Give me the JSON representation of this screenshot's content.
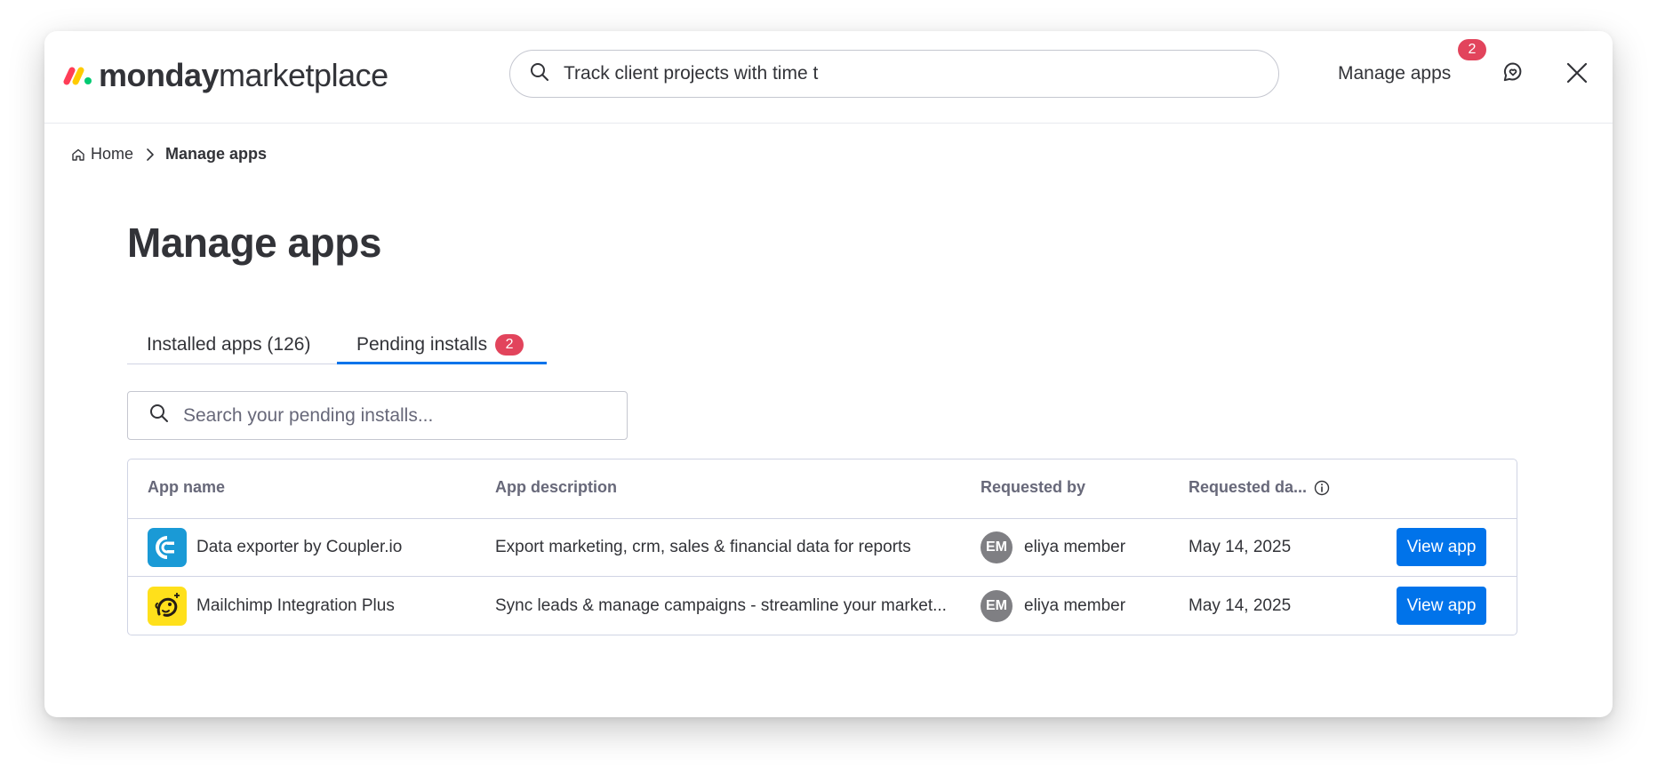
{
  "header": {
    "logo_bold": "monday",
    "logo_light": "marketplace",
    "search_value": "Track client projects with time t",
    "manage_apps_label": "Manage apps",
    "manage_apps_badge": "2",
    "icons": [
      "search-icon",
      "chat-icon",
      "close-icon"
    ]
  },
  "breadcrumb": {
    "home_label": "Home",
    "current_label": "Manage apps",
    "icons": [
      "home-icon",
      "chevron-right-icon"
    ]
  },
  "page": {
    "title": "Manage apps"
  },
  "tabs": [
    {
      "label": "Installed apps (126)",
      "active": false
    },
    {
      "label": "Pending installs",
      "badge": "2",
      "active": true
    }
  ],
  "pending_search": {
    "placeholder": "Search your pending installs..."
  },
  "table": {
    "columns": [
      "App name",
      "App description",
      "Requested by",
      "Requested da..."
    ],
    "rows": [
      {
        "app_name": "Data exporter by Coupler.io",
        "description": "Export marketing, crm, sales & financial data for reports",
        "requester_initials": "EM",
        "requester_name": "eliya member",
        "date": "May 14, 2025",
        "action_label": "View app",
        "icon": "coupler-icon"
      },
      {
        "app_name": "Mailchimp Integration Plus",
        "description": "Sync leads & manage campaigns - streamline your market...",
        "requester_initials": "EM",
        "requester_name": "eliya member",
        "date": "May 14, 2025",
        "action_label": "View app",
        "icon": "mailchimp-icon"
      }
    ]
  },
  "colors": {
    "accent": "#0073ea",
    "badge": "#e2445c",
    "text": "#323338",
    "secondary_text": "#676879",
    "border": "#d0d4e4",
    "coupler_bg": "#1a9ad6",
    "mailchimp_bg": "#ffe01b"
  }
}
